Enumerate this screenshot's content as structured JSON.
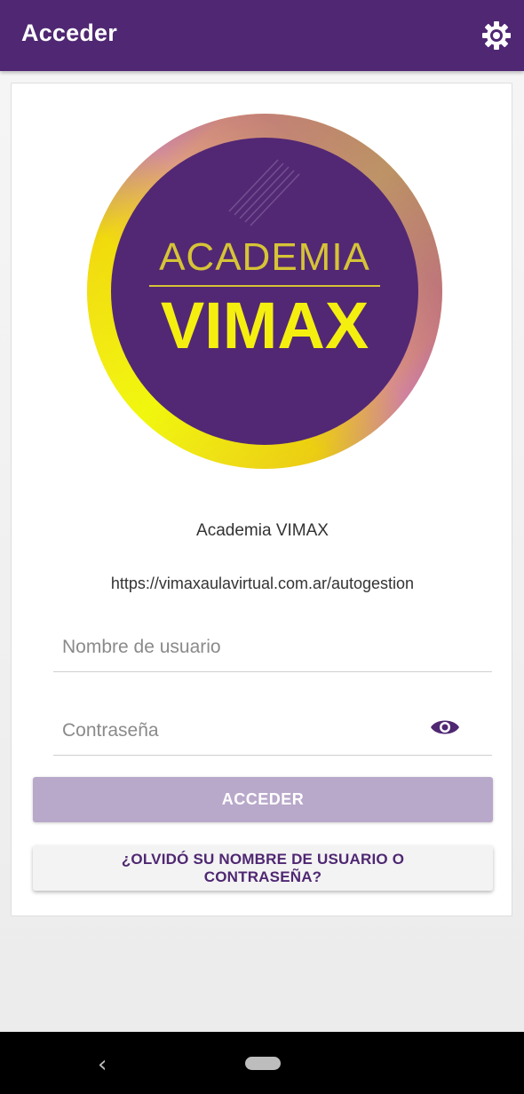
{
  "appbar": {
    "title": "Acceder",
    "settings_icon": "gear-icon",
    "color": "#4f2772"
  },
  "logo": {
    "line1": "ACADEMIA",
    "line2": "VIMAX"
  },
  "site": {
    "name": "Academia VIMAX",
    "url": "https://vimaxaulavirtual.com.ar/autogestion"
  },
  "form": {
    "username_placeholder": "Nombre de usuario",
    "username_value": "",
    "password_placeholder": "Contraseña",
    "password_value": "",
    "show_password_icon": "eye-icon",
    "login_label": "ACCEDER",
    "forgot_label": "¿OLVIDÓ SU NOMBRE DE USUARIO O CONTRASEÑA?"
  },
  "navbar": {
    "back_icon": "back-chevron-icon",
    "home_icon": "home-pill-icon"
  },
  "colors": {
    "accent": "#4f2772",
    "login_button": "#b8a8ca",
    "logo_yellow": "#f2f000",
    "logo_violet": "#8a1ff0"
  }
}
